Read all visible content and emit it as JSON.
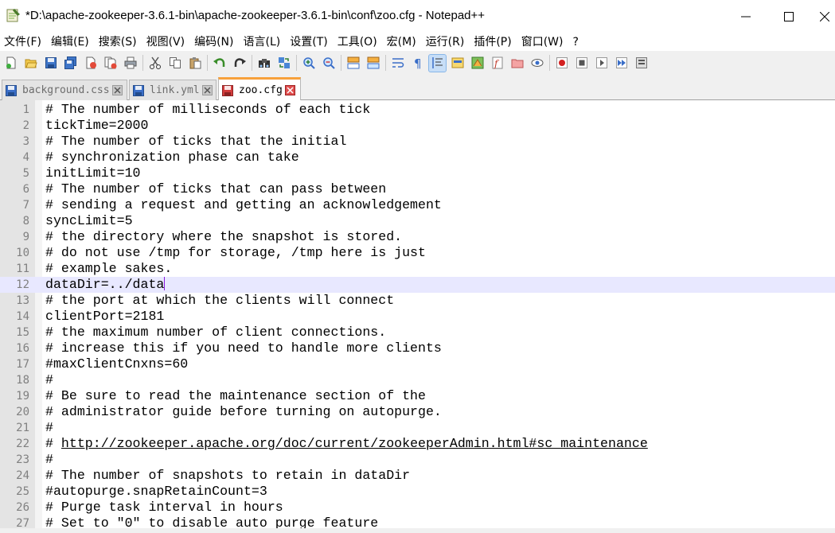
{
  "window": {
    "title": "*D:\\apache-zookeeper-3.6.1-bin\\apache-zookeeper-3.6.1-bin\\conf\\zoo.cfg - Notepad++"
  },
  "menu": [
    {
      "label": "文件(F)"
    },
    {
      "label": "编辑(E)"
    },
    {
      "label": "搜索(S)"
    },
    {
      "label": "视图(V)"
    },
    {
      "label": "编码(N)"
    },
    {
      "label": "语言(L)"
    },
    {
      "label": "设置(T)"
    },
    {
      "label": "工具(O)"
    },
    {
      "label": "宏(M)"
    },
    {
      "label": "运行(R)"
    },
    {
      "label": "插件(P)"
    },
    {
      "label": "窗口(W)"
    },
    {
      "label": "?"
    }
  ],
  "toolbar_icons": [
    "new-file-icon",
    "open-file-icon",
    "save-icon",
    "save-all-icon",
    "close-icon",
    "close-all-icon",
    "print-icon",
    "cut-icon",
    "copy-icon",
    "paste-icon",
    "undo-icon",
    "redo-icon",
    "find-icon",
    "replace-icon",
    "zoom-in-icon",
    "zoom-out-icon",
    "sync-vertical-icon",
    "sync-horizontal-icon",
    "word-wrap-icon",
    "show-all-chars-icon",
    "indent-guide-icon",
    "user-language-icon",
    "document-map-icon",
    "function-list-icon",
    "folder-workspace-icon",
    "monitoring-icon",
    "record-macro-icon",
    "stop-record-icon",
    "playback-macro-icon",
    "run-macro-multiple-icon",
    "save-macro-icon"
  ],
  "tabs": [
    {
      "label": "background.css",
      "active": false,
      "color": "#3a6ec8"
    },
    {
      "label": "link.yml",
      "active": false,
      "color": "#3a6ec8"
    },
    {
      "label": "zoo.cfg",
      "active": true,
      "color": "#d33c3c"
    }
  ],
  "editor": {
    "current_line": 12,
    "lines": [
      {
        "n": "1",
        "text": "# The number of milliseconds of each tick"
      },
      {
        "n": "2",
        "text": "tickTime=2000"
      },
      {
        "n": "3",
        "text": "# The number of ticks that the initial"
      },
      {
        "n": "4",
        "text": "# synchronization phase can take"
      },
      {
        "n": "5",
        "text": "initLimit=10"
      },
      {
        "n": "6",
        "text": "# The number of ticks that can pass between"
      },
      {
        "n": "7",
        "text": "# sending a request and getting an acknowledgement"
      },
      {
        "n": "8",
        "text": "syncLimit=5"
      },
      {
        "n": "9",
        "text": "# the directory where the snapshot is stored."
      },
      {
        "n": "10",
        "text": "# do not use /tmp for storage, /tmp here is just"
      },
      {
        "n": "11",
        "text": "# example sakes."
      },
      {
        "n": "12",
        "text": "dataDir=../data"
      },
      {
        "n": "13",
        "text": "# the port at which the clients will connect"
      },
      {
        "n": "14",
        "text": "clientPort=2181"
      },
      {
        "n": "15",
        "text": "# the maximum number of client connections."
      },
      {
        "n": "16",
        "text": "# increase this if you need to handle more clients"
      },
      {
        "n": "17",
        "text": "#maxClientCnxns=60"
      },
      {
        "n": "18",
        "text": "#"
      },
      {
        "n": "19",
        "text": "# Be sure to read the maintenance section of the"
      },
      {
        "n": "20",
        "text": "# administrator guide before turning on autopurge."
      },
      {
        "n": "21",
        "text": "#"
      },
      {
        "n": "22",
        "text": "# ",
        "link": "http://zookeeper.apache.org/doc/current/zookeeperAdmin.html#sc_maintenance"
      },
      {
        "n": "23",
        "text": "#"
      },
      {
        "n": "24",
        "text": "# The number of snapshots to retain in dataDir"
      },
      {
        "n": "25",
        "text": "#autopurge.snapRetainCount=3"
      },
      {
        "n": "26",
        "text": "# Purge task interval in hours"
      },
      {
        "n": "27",
        "text": "# Set to \"0\" to disable auto purge feature"
      }
    ]
  }
}
